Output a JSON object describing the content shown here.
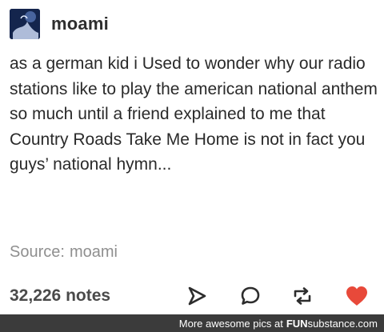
{
  "post": {
    "username": "moami",
    "body": "as a german kid i Used to wonder why our radio stations like to play the american national anthem so much until a friend explained to me that Country Roads Take Me Home is not in fact you guys’ national hymn...",
    "source_label": "Source:",
    "source_value": "moami",
    "notes": "32,226 notes"
  },
  "icons": {
    "avatar": "avatar-image",
    "share": "share-icon",
    "reply": "reply-icon",
    "reblog": "reblog-icon",
    "like": "heart-icon"
  },
  "colors": {
    "like": "#e8493a",
    "watermark_bg": "#3b3b3b"
  },
  "watermark": {
    "text": "More awesome pics at",
    "brand_bold": "FUN",
    "brand_rest": "substance.com"
  }
}
